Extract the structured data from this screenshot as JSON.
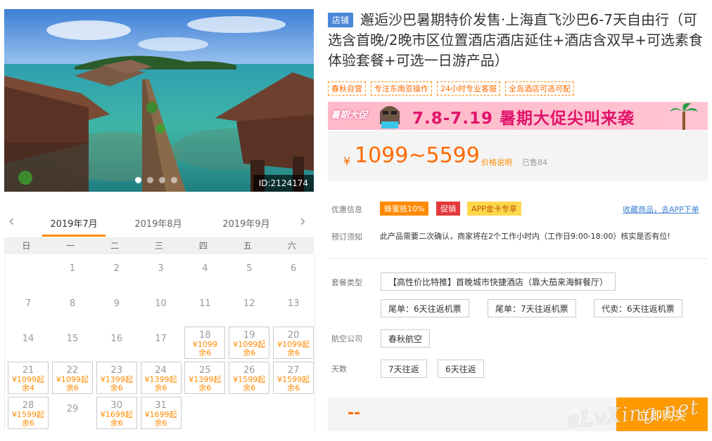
{
  "hero": {
    "image_id": "ID:2124174",
    "slide_count": 4,
    "active_slide": 1
  },
  "calendar": {
    "months": [
      "2019年7月",
      "2019年8月",
      "2019年9月"
    ],
    "active_month": "2019年7月",
    "weekdays": [
      "日",
      "一",
      "二",
      "三",
      "四",
      "五",
      "六"
    ],
    "days": [
      {
        "d": "1",
        "price": "",
        "rem": ""
      },
      {
        "d": "2",
        "price": "",
        "rem": ""
      },
      {
        "d": "3",
        "price": "",
        "rem": ""
      },
      {
        "d": "4",
        "price": "",
        "rem": ""
      },
      {
        "d": "5",
        "price": "",
        "rem": ""
      },
      {
        "d": "6",
        "price": "",
        "rem": ""
      },
      {
        "d": "7",
        "price": "",
        "rem": ""
      },
      {
        "d": "8",
        "price": "",
        "rem": ""
      },
      {
        "d": "9",
        "price": "",
        "rem": ""
      },
      {
        "d": "10",
        "price": "",
        "rem": ""
      },
      {
        "d": "11",
        "price": "",
        "rem": ""
      },
      {
        "d": "12",
        "price": "",
        "rem": ""
      },
      {
        "d": "13",
        "price": "",
        "rem": ""
      },
      {
        "d": "14",
        "price": "",
        "rem": ""
      },
      {
        "d": "15",
        "price": "",
        "rem": ""
      },
      {
        "d": "16",
        "price": "",
        "rem": ""
      },
      {
        "d": "17",
        "price": "",
        "rem": ""
      },
      {
        "d": "18",
        "price": "¥1099",
        "rem": "余6"
      },
      {
        "d": "19",
        "price": "¥1099起",
        "rem": "余6"
      },
      {
        "d": "20",
        "price": "¥1099起",
        "rem": "余6"
      },
      {
        "d": "21",
        "price": "¥1099起",
        "rem": "余4"
      },
      {
        "d": "22",
        "price": "¥1099起",
        "rem": "余6"
      },
      {
        "d": "23",
        "price": "¥1399起",
        "rem": "余6"
      },
      {
        "d": "24",
        "price": "¥1399起",
        "rem": "余6"
      },
      {
        "d": "25",
        "price": "¥1399起",
        "rem": "余6"
      },
      {
        "d": "26",
        "price": "¥1599起",
        "rem": "余6"
      },
      {
        "d": "27",
        "price": "¥1599起",
        "rem": "余6"
      },
      {
        "d": "28",
        "price": "¥1599起",
        "rem": "余6"
      },
      {
        "d": "29",
        "price": "",
        "rem": ""
      },
      {
        "d": "30",
        "price": "¥1699起",
        "rem": "余6"
      },
      {
        "d": "31",
        "price": "¥1699起",
        "rem": "余6"
      }
    ],
    "first_weekday": 1
  },
  "product": {
    "shop_badge": "店铺",
    "title": "邂逅沙巴暑期特价发售·上海直飞沙巴6-7天自由行（可选含首晚/2晚市区位置酒店酒店延住+酒店含双早+可选素食体验套餐+可选一日游产品）",
    "tags": [
      "春秋自营",
      "专注东南亚操作",
      "24小时专业客服",
      "全岛酒店可选可配"
    ],
    "banner_label": "暑期大促",
    "banner_text": "7.8-7.19 暑期大促尖叫来袭",
    "price_currency": "¥",
    "price_range": "1099~5599",
    "price_note": "价格说明",
    "sold": "已售84"
  },
  "offers": {
    "label": "优惠信息",
    "badges": [
      "蜂蜜抵10%",
      "促销",
      "APP金卡专享"
    ],
    "fav_link": "收藏商品，去APP下单"
  },
  "notice": {
    "label": "预订须知",
    "text": "此产品需要二次确认，商家将在2个工作小时内（工作日9:00-18:00）核实是否有位!"
  },
  "package": {
    "label": "套餐类型",
    "options": [
      "【高性价比特推】首晚城市快捷酒店（靠大茄来海鲜餐厅）",
      "尾单：6天往返机票",
      "尾单：7天往返机票",
      "代卖：6天往返机票"
    ]
  },
  "airline": {
    "label": "航空公司",
    "options": [
      "春秋航空"
    ]
  },
  "days": {
    "label": "天数",
    "options": [
      "7天往返",
      "6天往返"
    ]
  },
  "bottom": {
    "price": "--",
    "buy_label": "立即购买"
  },
  "watermark": "eLvXing.net",
  "colors": {
    "accent": "#ff8a00",
    "price": "#ff6a00",
    "badge_blue": "#4b86d8",
    "promo_red": "#e4393c",
    "banner_pink": "#ffc4d2"
  }
}
